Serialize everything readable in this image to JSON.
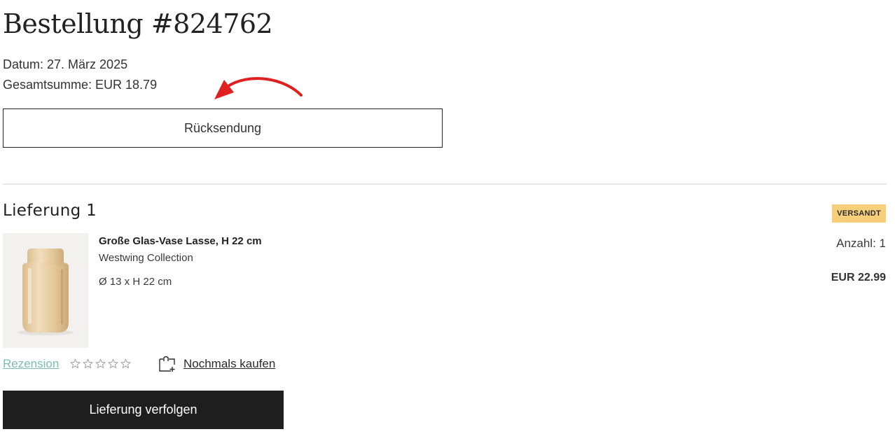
{
  "order": {
    "title": "Bestellung #824762",
    "date_line": "Datum: 27. März 2025",
    "total_line": "Gesamtsumme: EUR 18.79",
    "return_button_label": "Rücksendung"
  },
  "delivery": {
    "title": "Lieferung 1",
    "status_badge": "VERSANDT",
    "status_color": "#f7cf7b",
    "item": {
      "name": "Große Glas-Vase Lasse, H 22 cm",
      "brand": "Westwing Collection",
      "dimensions": "Ø 13 x H 22 cm",
      "quantity": "Anzahl: 1",
      "price": "EUR 22.99",
      "image_icon": "vase-image"
    },
    "review_link": "Rezension",
    "review_color": "#7bbfae",
    "rating": {
      "filled": 0,
      "max": 5
    },
    "rebuy_label": "Nochmals kaufen",
    "rebuy_icon": "bag-plus-icon",
    "track_button_label": "Lieferung verfolgen"
  },
  "annotation": {
    "arrow_color": "#e02020"
  }
}
